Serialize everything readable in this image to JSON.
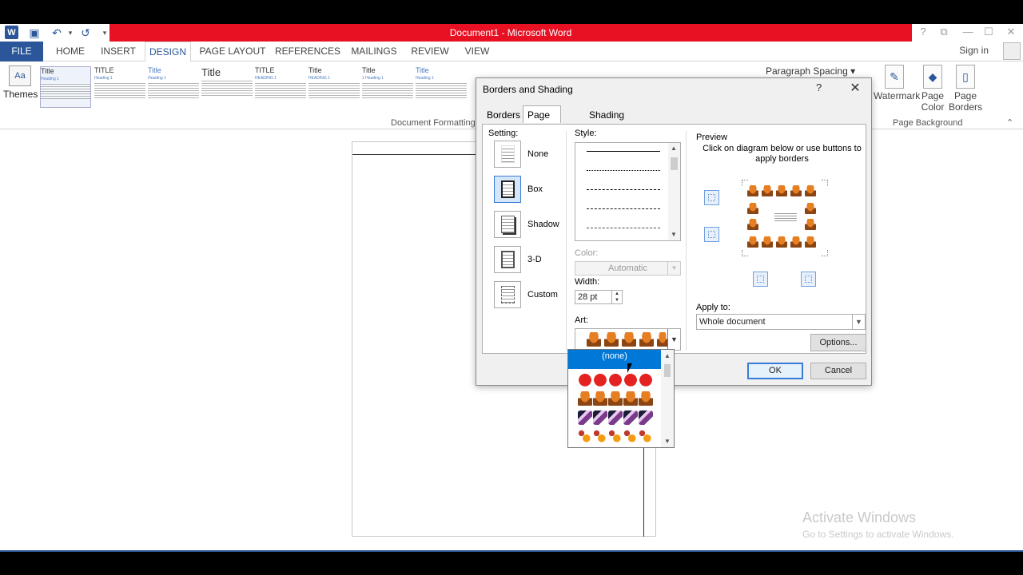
{
  "window": {
    "title": "Document1 - Microsoft Word",
    "controls": {
      "help": "?",
      "restore": "⧉",
      "minimize": "—",
      "maximize": "☐",
      "close": "✕"
    }
  },
  "qat": {
    "logo": "W",
    "save": "💾",
    "undo": "↶",
    "undo_drop": "▾",
    "redo": "↺",
    "customize": "▾"
  },
  "tabs": [
    "FILE",
    "HOME",
    "INSERT",
    "DESIGN",
    "PAGE LAYOUT",
    "REFERENCES",
    "MAILINGS",
    "REVIEW",
    "VIEW"
  ],
  "signin": "Sign in",
  "ribbon": {
    "themes_label": "Themes",
    "themes_icon_text": "Aa",
    "style_thumbs": [
      {
        "title": "Title",
        "sub": "Heading 1"
      },
      {
        "title": "TITLE",
        "sub": "Heading 1"
      },
      {
        "title": "Title",
        "sub": "Heading 1"
      },
      {
        "title": "Title",
        "sub": ""
      },
      {
        "title": "TITLE",
        "sub": "HEADING 1"
      },
      {
        "title": "Title",
        "sub": "HEADING 1"
      },
      {
        "title": "Title",
        "sub": "1 Heading 1"
      },
      {
        "title": "Title",
        "sub": "Heading 1"
      }
    ],
    "document_formatting_label": "Document Formatting",
    "paragraph_spacing": "Paragraph Spacing",
    "watermark": "Watermark",
    "page_color": "Page Color",
    "page_borders_line1": "Page",
    "page_borders_line2": "Borders",
    "page_background_label": "Page Background"
  },
  "dialog": {
    "title": "Borders and Shading",
    "help": "?",
    "close": "✕",
    "tabs": [
      "Borders",
      "Page Border",
      "Shading"
    ],
    "setting_label": "Setting:",
    "settings": [
      "None",
      "Box",
      "Shadow",
      "3-D",
      "Custom"
    ],
    "selected_setting": "Box",
    "style_label": "Style:",
    "color_label": "Color:",
    "color_value": "Automatic",
    "width_label": "Width:",
    "width_value": "28 pt",
    "art_label": "Art:",
    "preview_label": "Preview",
    "preview_instructions": "Click on diagram below or use buttons to apply borders",
    "apply_to_label": "Apply to:",
    "apply_to_value": "Whole document",
    "options_button": "Options...",
    "ok_button": "OK",
    "cancel_button": "Cancel",
    "art_options": [
      "(none)",
      "apples",
      "muffins",
      "cake slices",
      "candy corn"
    ],
    "art_selected_highlight": "(none)"
  },
  "activation": {
    "line1": "Activate Windows",
    "line2": "Go to Settings to activate Windows."
  },
  "colors": {
    "title_bar_red": "#e81123",
    "word_blue": "#2b579a",
    "selection_blue": "#0078d7"
  }
}
